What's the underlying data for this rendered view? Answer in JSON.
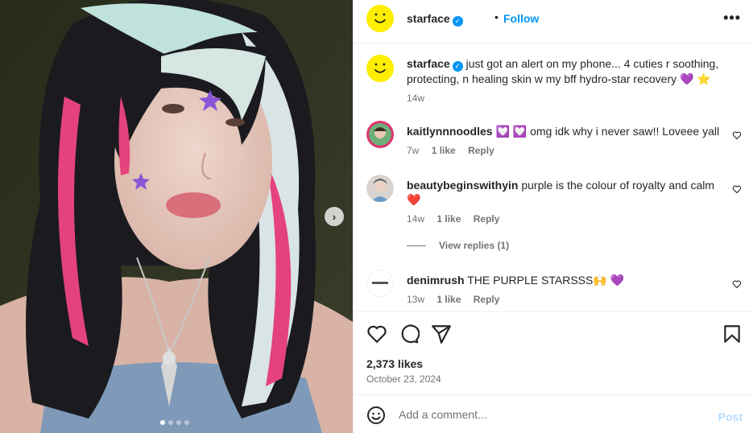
{
  "post": {
    "author": "starface",
    "follow_label": "Follow",
    "bullet": "•",
    "more_label": "•••",
    "next_label": "›",
    "carousel_pages": 4,
    "carousel_active": 1
  },
  "caption": {
    "username": "starface",
    "text": "just got an alert on my phone... 4 cuties r soothing, protecting, n healing skin w my bff hydro-star recovery 💜 ⭐",
    "time": "14w"
  },
  "comments": [
    {
      "username": "kaitlynnnoodles",
      "text": "💟 💟 omg idk why i never saw!! Loveee yall",
      "time": "7w",
      "likes": "1 like",
      "reply_label": "Reply"
    },
    {
      "username": "beautybeginswithyin",
      "text": "purple is the colour of royalty and calm ❤️",
      "time": "14w",
      "likes": "1 like",
      "reply_label": "Reply"
    },
    {
      "username": "denimrush",
      "text": "THE PURPLE STARSSS🙌 💜",
      "time": "13w",
      "likes": "1 like",
      "reply_label": "Reply"
    }
  ],
  "view_replies": "View replies (1)",
  "likes_count": "2,373 likes",
  "date": "October 23, 2024",
  "add_comment": {
    "placeholder": "Add a comment...",
    "post_label": "Post"
  },
  "colors": {
    "brand_yellow": "#ffee00",
    "link_blue": "#0095f6",
    "post_disabled": "#b3dbff"
  },
  "icons": [
    "smiley-logo-icon",
    "verified-badge-icon",
    "more-options-icon",
    "chevron-right-icon",
    "heart-icon",
    "comment-icon",
    "share-icon",
    "bookmark-icon",
    "emoji-icon"
  ]
}
